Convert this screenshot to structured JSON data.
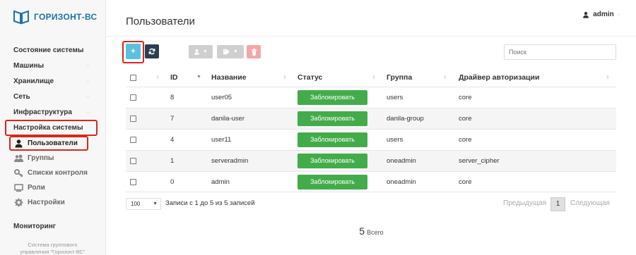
{
  "app": {
    "logo_text": "ГОРИЗОНТ-ВС"
  },
  "sidebar": {
    "items": [
      {
        "label": "Состояние системы",
        "has_chevron": false
      },
      {
        "label": "Машины",
        "has_chevron": true
      },
      {
        "label": "Хранилище",
        "has_chevron": true
      },
      {
        "label": "Сеть",
        "has_chevron": true
      },
      {
        "label": "Инфраструктура",
        "has_chevron": true
      },
      {
        "label": "Настройка системы",
        "has_chevron": false
      }
    ],
    "subitems": [
      {
        "label": "Пользователи",
        "icon": "user-icon",
        "active": true
      },
      {
        "label": "Группы",
        "icon": "users-icon",
        "active": false
      },
      {
        "label": "Списки контроля",
        "icon": "key-icon",
        "active": false
      },
      {
        "label": "Роли",
        "icon": "screen-icon",
        "active": false
      },
      {
        "label": "Настройки",
        "icon": "gear-icon",
        "active": false
      }
    ],
    "monitoring": "Мониторинг",
    "footer_line1": "Система группового",
    "footer_line2": "управления \"Горизонт-ВС\""
  },
  "header": {
    "title": "Пользователи",
    "user": "admin"
  },
  "toolbar": {
    "add_label": "+",
    "refresh_icon": "refresh-icon",
    "search_placeholder": "Поиск",
    "colors": {
      "add": "#5bc0de",
      "refresh": "#2c3e50",
      "disabled": "#cfcfcf",
      "delete": "#f3a6a6"
    }
  },
  "table": {
    "headers": [
      "ID",
      "Название",
      "Статус",
      "Группа",
      "Драйвер авторизации"
    ],
    "rows": [
      {
        "id": "8",
        "name": "user05",
        "status": "Заблокировать",
        "group": "users",
        "driver": "core"
      },
      {
        "id": "7",
        "name": "danila-user",
        "status": "Заблокировать",
        "group": "danila-group",
        "driver": "core"
      },
      {
        "id": "4",
        "name": "user11",
        "status": "Заблокировать",
        "group": "users",
        "driver": "core"
      },
      {
        "id": "1",
        "name": "serveradmin",
        "status": "Заблокировать",
        "group": "oneadmin",
        "driver": "server_cipher"
      },
      {
        "id": "0",
        "name": "admin",
        "status": "Заблокировать",
        "group": "oneadmin",
        "driver": "core"
      }
    ]
  },
  "footer": {
    "per_page": "100",
    "info": "Записи с 1 до 5 из 5 записей",
    "prev": "Предыдущая",
    "page": "1",
    "next": "Следующая",
    "total_count": "5",
    "total_label": "Всего"
  }
}
